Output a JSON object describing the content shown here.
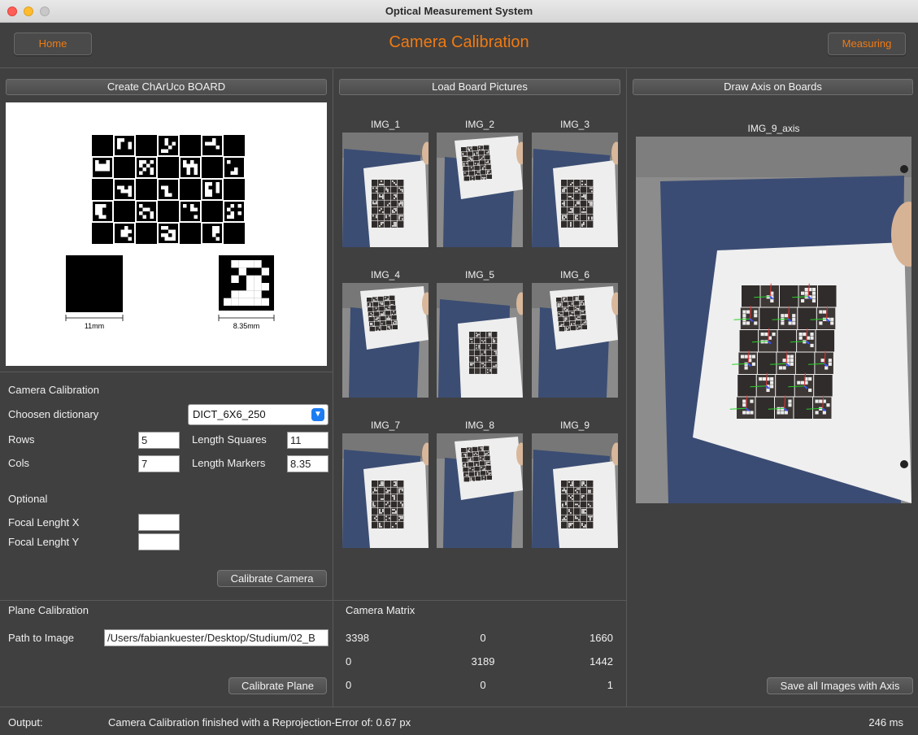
{
  "window": {
    "title": "Optical Measurement System"
  },
  "header": {
    "home_label": "Home",
    "page_title": "Camera Calibration",
    "measuring_label": "Measuring"
  },
  "sections": {
    "create_board": "Create ChArUco BOARD",
    "load_pictures": "Load Board Pictures",
    "draw_axis": "Draw Axis on Boards"
  },
  "board_preview": {
    "square_dim": "11mm",
    "marker_dim": "8.35mm"
  },
  "camera_calibration": {
    "heading": "Camera Calibration",
    "dictionary_label": "Choosen dictionary",
    "dictionary_value": "DICT_6X6_250",
    "rows_label": "Rows",
    "rows_value": "5",
    "cols_label": "Cols",
    "cols_value": "7",
    "length_squares_label": "Length Squares",
    "length_squares_value": "11",
    "length_markers_label": "Length Markers",
    "length_markers_value": "8.35",
    "optional_label": "Optional",
    "focal_x_label": "Focal Lenght X",
    "focal_x_value": "",
    "focal_y_label": "Focal Lenght Y",
    "focal_y_value": "",
    "calibrate_button": "Calibrate Camera"
  },
  "plane_calibration": {
    "heading": "Plane Calibration",
    "path_label": "Path to Image",
    "path_value": "/Users/fabiankuester/Desktop/Studium/02_B",
    "calibrate_button": "Calibrate Plane"
  },
  "images": [
    {
      "label": "IMG_1",
      "variant": "flat"
    },
    {
      "label": "IMG_2",
      "variant": "tilt"
    },
    {
      "label": "IMG_3",
      "variant": "flat"
    },
    {
      "label": "IMG_4",
      "variant": "tilt"
    },
    {
      "label": "IMG_5",
      "variant": "lower"
    },
    {
      "label": "IMG_6",
      "variant": "tilt"
    },
    {
      "label": "IMG_7",
      "variant": "flat"
    },
    {
      "label": "IMG_8",
      "variant": "tilt"
    },
    {
      "label": "IMG_9",
      "variant": "flat"
    }
  ],
  "axis_image": {
    "label": "IMG_9_axis"
  },
  "camera_matrix": {
    "heading": "Camera Matrix",
    "rows": [
      [
        "3398",
        "0",
        "1660"
      ],
      [
        "0",
        "3189",
        "1442"
      ],
      [
        "0",
        "0",
        "1"
      ]
    ]
  },
  "save_axis_button": "Save all Images with Axis",
  "status": {
    "output_label": "Output:",
    "message": "Camera Calibration finished with a Reprojection-Error of: 0.67 px",
    "time": "246 ms"
  },
  "colors": {
    "accent": "#f07a12",
    "background": "#404040",
    "combo_arrow": "#1e7cf2"
  }
}
